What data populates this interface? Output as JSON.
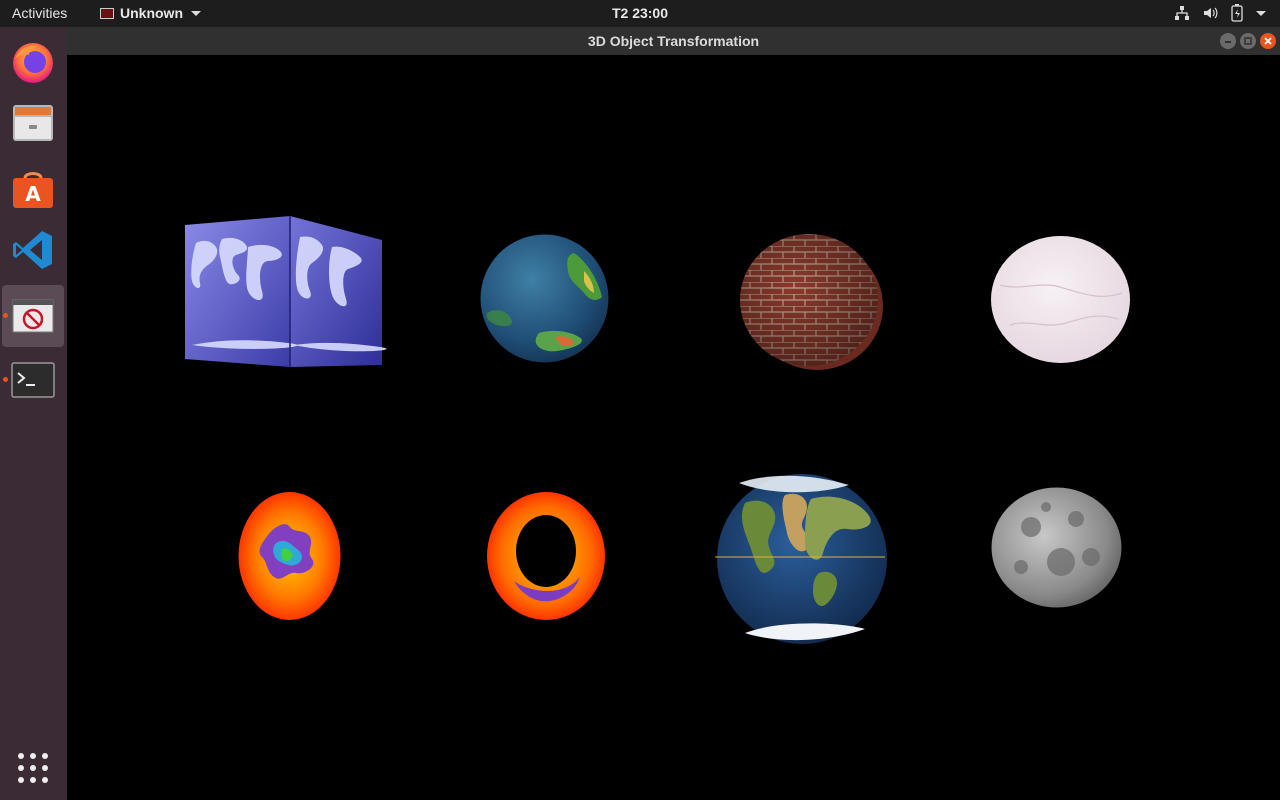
{
  "topbar": {
    "activities": "Activities",
    "app_name": "Unknown",
    "clock": "T2 23:00"
  },
  "window": {
    "title": "3D Object Transformation"
  },
  "dock": {
    "items": [
      "firefox",
      "files",
      "software",
      "vscode",
      "opengl-app",
      "terminal",
      "show-apps"
    ],
    "accent": "#e95420"
  },
  "scene": {
    "background": "#000000",
    "objects": [
      {
        "shape": "cube",
        "texture": "world-map-blue"
      },
      {
        "shape": "sphere",
        "texture": "earth-terrain"
      },
      {
        "shape": "cylinder",
        "texture": "brick"
      },
      {
        "shape": "sphere",
        "texture": "marble"
      },
      {
        "shape": "disc",
        "texture": "fractal"
      },
      {
        "shape": "torus",
        "texture": "fractal"
      },
      {
        "shape": "sphere",
        "texture": "earth-satellite"
      },
      {
        "shape": "sphere",
        "texture": "moon"
      }
    ]
  }
}
